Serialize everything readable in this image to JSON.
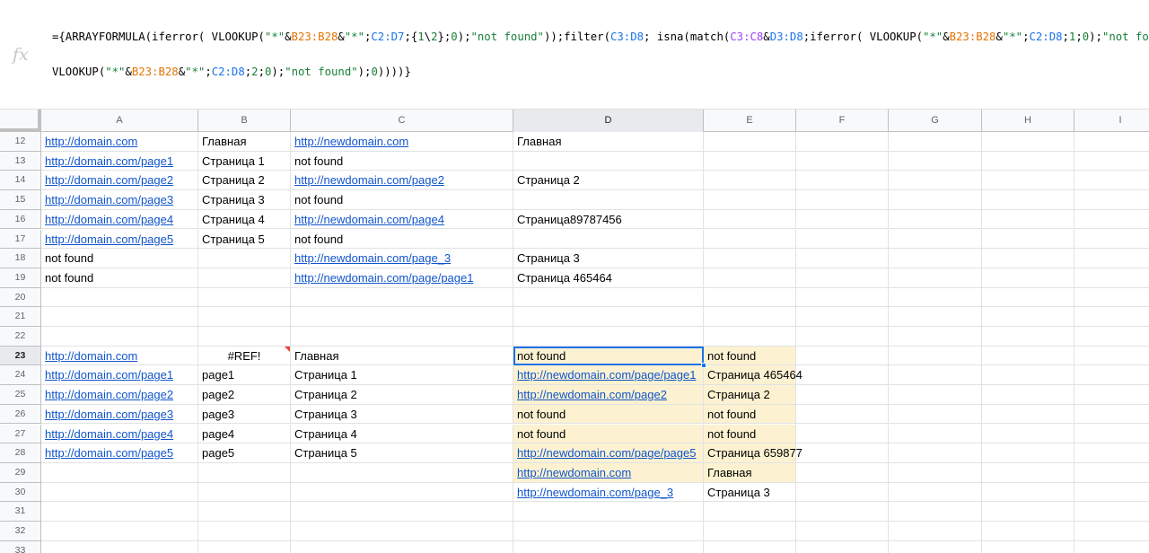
{
  "formula_bar": {
    "fx_label": "fx",
    "line1": [
      {
        "t": "={ARRAYFORMULA(iferror( VLOOKUP(",
        "c": "#000000"
      },
      {
        "t": "\"*\"",
        "c": "#188038"
      },
      {
        "t": "&",
        "c": "#000000"
      },
      {
        "t": "B23:B28",
        "c": "#e37400"
      },
      {
        "t": "&",
        "c": "#000000"
      },
      {
        "t": "\"*\"",
        "c": "#188038"
      },
      {
        "t": ";",
        "c": "#000000"
      },
      {
        "t": "C2:D7",
        "c": "#1a73e8"
      },
      {
        "t": ";{",
        "c": "#000000"
      },
      {
        "t": "1",
        "c": "#188038"
      },
      {
        "t": "\\",
        "c": "#000000"
      },
      {
        "t": "2",
        "c": "#188038"
      },
      {
        "t": "};",
        "c": "#000000"
      },
      {
        "t": "0",
        "c": "#188038"
      },
      {
        "t": ");",
        "c": "#000000"
      },
      {
        "t": "\"not found\"",
        "c": "#188038"
      },
      {
        "t": "));filter(",
        "c": "#000000"
      },
      {
        "t": "C3:D8",
        "c": "#1a73e8"
      },
      {
        "t": "; isna(match(",
        "c": "#000000"
      },
      {
        "t": "C3:C8",
        "c": "#a142f4"
      },
      {
        "t": "&",
        "c": "#000000"
      },
      {
        "t": "D3:D8",
        "c": "#1a73e8"
      },
      {
        "t": ";iferror( VLOOKUP(",
        "c": "#000000"
      },
      {
        "t": "\"*\"",
        "c": "#188038"
      },
      {
        "t": "&",
        "c": "#000000"
      },
      {
        "t": "B23:B28",
        "c": "#e37400"
      },
      {
        "t": "&",
        "c": "#000000"
      },
      {
        "t": "\"*\"",
        "c": "#188038"
      },
      {
        "t": ";",
        "c": "#000000"
      },
      {
        "t": "C2:D8",
        "c": "#1a73e8"
      },
      {
        "t": ";",
        "c": "#000000"
      },
      {
        "t": "1",
        "c": "#188038"
      },
      {
        "t": ";",
        "c": "#000000"
      },
      {
        "t": "0",
        "c": "#188038"
      },
      {
        "t": ");",
        "c": "#000000"
      },
      {
        "t": "\"not found\"",
        "c": "#188038"
      },
      {
        "t": ")&",
        "c": "#000000"
      }
    ],
    "line2": [
      {
        "t": "VLOOKUP(",
        "c": "#000000"
      },
      {
        "t": "\"*\"",
        "c": "#188038"
      },
      {
        "t": "&",
        "c": "#000000"
      },
      {
        "t": "B23:B28",
        "c": "#e37400"
      },
      {
        "t": "&",
        "c": "#000000"
      },
      {
        "t": "\"*\"",
        "c": "#188038"
      },
      {
        "t": ";",
        "c": "#000000"
      },
      {
        "t": "C2:D8",
        "c": "#1a73e8"
      },
      {
        "t": ";",
        "c": "#000000"
      },
      {
        "t": "2",
        "c": "#188038"
      },
      {
        "t": ";",
        "c": "#000000"
      },
      {
        "t": "0",
        "c": "#188038"
      },
      {
        "t": ");",
        "c": "#000000"
      },
      {
        "t": "\"not found\"",
        "c": "#188038"
      },
      {
        "t": ");",
        "c": "#000000"
      },
      {
        "t": "0",
        "c": "#188038"
      },
      {
        "t": "))))}",
        "c": "#000000"
      }
    ]
  },
  "columns": [
    "A",
    "B",
    "C",
    "D",
    "E",
    "F",
    "G",
    "H",
    "I"
  ],
  "selected_cell": "D23",
  "colors": {
    "link": "#1155cc",
    "highlight": "#fcf2d2",
    "selection": "#1a73e8",
    "error_marker": "#ea4335"
  },
  "rows": [
    {
      "num": "12",
      "cells": {
        "A": {
          "v": "http://domain.com",
          "link": true
        },
        "B": {
          "v": "Главная"
        },
        "C": {
          "v": "http://newdomain.com",
          "link": true
        },
        "D": {
          "v": "Главная"
        }
      }
    },
    {
      "num": "13",
      "cells": {
        "A": {
          "v": "http://domain.com/page1",
          "link": true
        },
        "B": {
          "v": "Страница 1"
        },
        "C": {
          "v": "not found"
        }
      }
    },
    {
      "num": "14",
      "cells": {
        "A": {
          "v": "http://domain.com/page2",
          "link": true
        },
        "B": {
          "v": "Страница 2"
        },
        "C": {
          "v": "http://newdomain.com/page2",
          "link": true
        },
        "D": {
          "v": "Страница 2"
        }
      }
    },
    {
      "num": "15",
      "cells": {
        "A": {
          "v": "http://domain.com/page3",
          "link": true
        },
        "B": {
          "v": "Страница 3"
        },
        "C": {
          "v": "not found"
        }
      }
    },
    {
      "num": "16",
      "cells": {
        "A": {
          "v": "http://domain.com/page4",
          "link": true
        },
        "B": {
          "v": "Страница 4"
        },
        "C": {
          "v": "http://newdomain.com/page4",
          "link": true
        },
        "D": {
          "v": "Страница89787456"
        }
      }
    },
    {
      "num": "17",
      "cells": {
        "A": {
          "v": "http://domain.com/page5",
          "link": true
        },
        "B": {
          "v": "Страница 5"
        },
        "C": {
          "v": "not found"
        }
      }
    },
    {
      "num": "18",
      "cells": {
        "A": {
          "v": "not found"
        },
        "C": {
          "v": "http://newdomain.com/page_3",
          "link": true
        },
        "D": {
          "v": "Страница 3"
        }
      }
    },
    {
      "num": "19",
      "cells": {
        "A": {
          "v": "not found"
        },
        "C": {
          "v": "http://newdomain.com/page/page1",
          "link": true
        },
        "D": {
          "v": "Страница 465464"
        }
      }
    },
    {
      "num": "20",
      "cells": {}
    },
    {
      "num": "21",
      "cells": {}
    },
    {
      "num": "22",
      "cells": {}
    },
    {
      "num": "23",
      "cells": {
        "A": {
          "v": "http://domain.com",
          "link": true
        },
        "B": {
          "v": "#REF!",
          "center": true,
          "error": true
        },
        "C": {
          "v": "Главная"
        },
        "D": {
          "v": "not found",
          "hl": true,
          "selected": true
        },
        "E": {
          "v": "not found",
          "hl": true
        }
      }
    },
    {
      "num": "24",
      "cells": {
        "A": {
          "v": "http://domain.com/page1",
          "link": true
        },
        "B": {
          "v": "page1"
        },
        "C": {
          "v": "Страница 1"
        },
        "D": {
          "v": "http://newdomain.com/page/page1",
          "link": true,
          "hl": true
        },
        "E": {
          "v": "Страница 465464",
          "hl": true
        }
      }
    },
    {
      "num": "25",
      "cells": {
        "A": {
          "v": "http://domain.com/page2",
          "link": true
        },
        "B": {
          "v": "page2"
        },
        "C": {
          "v": "Страница 2"
        },
        "D": {
          "v": "http://newdomain.com/page2",
          "link": true,
          "hl": true
        },
        "E": {
          "v": "Страница 2",
          "hl": true
        }
      }
    },
    {
      "num": "26",
      "cells": {
        "A": {
          "v": "http://domain.com/page3",
          "link": true
        },
        "B": {
          "v": "page3"
        },
        "C": {
          "v": "Страница 3"
        },
        "D": {
          "v": "not found",
          "hl": true
        },
        "E": {
          "v": "not found",
          "hl": true
        }
      }
    },
    {
      "num": "27",
      "cells": {
        "A": {
          "v": "http://domain.com/page4",
          "link": true
        },
        "B": {
          "v": "page4"
        },
        "C": {
          "v": "Страница 4"
        },
        "D": {
          "v": "not found",
          "hl": true
        },
        "E": {
          "v": "not found",
          "hl": true
        }
      }
    },
    {
      "num": "28",
      "cells": {
        "A": {
          "v": "http://domain.com/page5",
          "link": true
        },
        "B": {
          "v": "page5"
        },
        "C": {
          "v": "Страница 5"
        },
        "D": {
          "v": "http://newdomain.com/page/page5",
          "link": true,
          "hl": true
        },
        "E": {
          "v": "Страница 659877",
          "hl": true
        }
      }
    },
    {
      "num": "29",
      "cells": {
        "D": {
          "v": "http://newdomain.com",
          "link": true,
          "hl": true
        },
        "E": {
          "v": "Главная",
          "hl": true
        }
      }
    },
    {
      "num": "30",
      "cells": {
        "D": {
          "v": "http://newdomain.com/page_3",
          "link": true
        },
        "E": {
          "v": "Страница 3"
        }
      }
    },
    {
      "num": "31",
      "cells": {}
    },
    {
      "num": "32",
      "cells": {}
    },
    {
      "num": "33",
      "cells": {}
    }
  ]
}
